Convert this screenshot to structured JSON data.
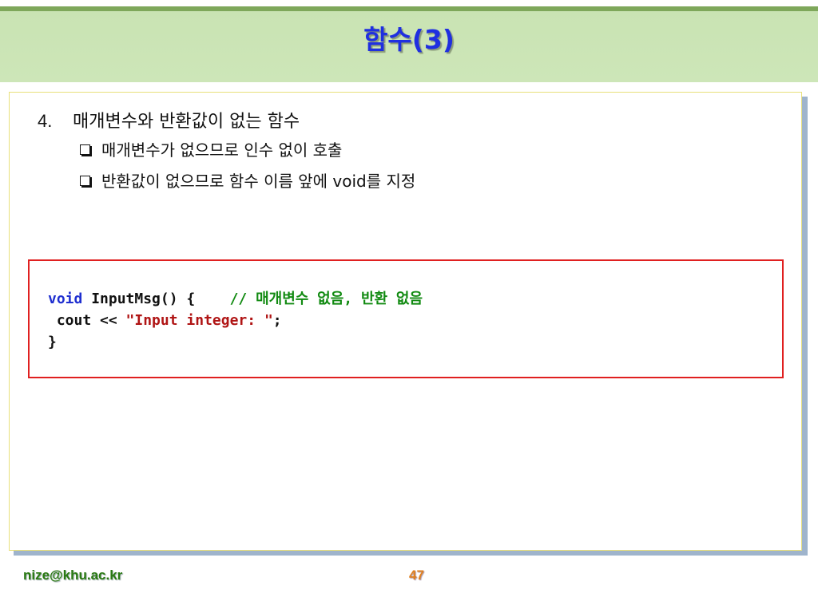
{
  "slide": {
    "title": "함수(3)",
    "heading_number": "4.",
    "heading_text": "매개변수와 반환값이 없는 함수",
    "bullets": [
      "매개변수가 없으므로 인수 없이 호출",
      "반환값이 없으므로 함수 이름 앞에 void를 지정"
    ],
    "code": {
      "line1_keyword": "void",
      "line1_rest": " InputMsg() {    ",
      "line1_comment": "// 매개변수 없음, 반환 없음",
      "line2_prefix": " cout << ",
      "line2_string": "\"Input integer: \"",
      "line2_suffix": ";",
      "line3": "}"
    },
    "footer": {
      "email": "nize@khu.ac.kr",
      "page_number": "47"
    }
  },
  "colors": {
    "title_text": "#1f2fe0",
    "title_bar": "#cde6b8",
    "code_border": "#e02020",
    "keyword": "#1f2fd0",
    "string": "#b01515",
    "comment": "#118a11",
    "email": "#2a7a12",
    "page_number": "#e08020"
  }
}
